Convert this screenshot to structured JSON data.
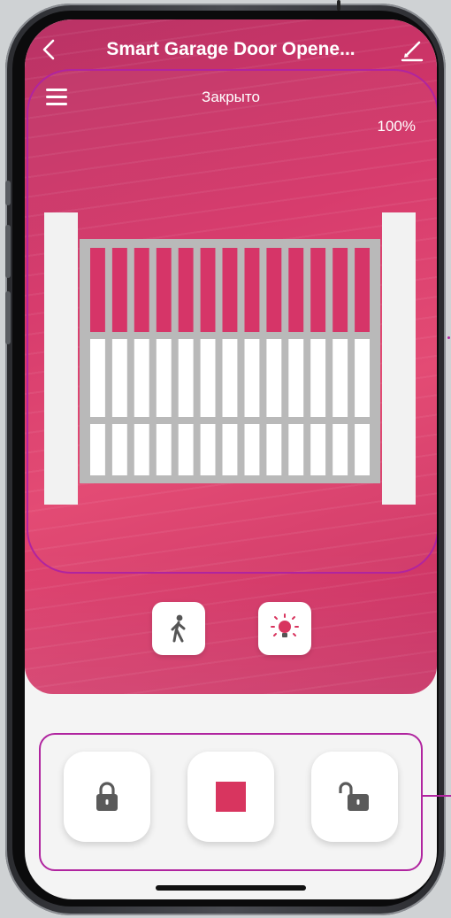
{
  "header": {
    "title": "Smart Garage Door Opene..."
  },
  "gate_panel": {
    "status": "Закрыто",
    "percent": "100%",
    "open_level": 1.0
  },
  "action_buttons": [
    {
      "icon": "pedestrian-icon"
    },
    {
      "icon": "light-bulb-icon"
    }
  ],
  "controls": [
    {
      "icon": "lock-closed-icon"
    },
    {
      "icon": "stop-square-icon"
    },
    {
      "icon": "lock-open-icon"
    }
  ],
  "colors": {
    "accent": "#d63568",
    "highlight_frame": "#b0249f",
    "icon_grey": "#5a5a5a",
    "stop_red": "#d8355f"
  }
}
